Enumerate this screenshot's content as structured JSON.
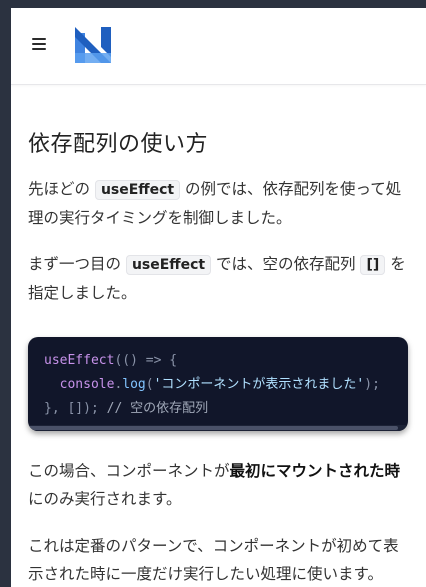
{
  "header": {
    "menu_icon": "hamburger-menu-icon",
    "logo_icon": "n-logo-icon",
    "logo_colors": {
      "dark": "#1f5fbf",
      "light": "#5aa0f0",
      "mid": "#3f83e0"
    }
  },
  "article": {
    "heading": "依存配列の使い方",
    "para1": {
      "before": "先ほどの ",
      "code": "useEffect",
      "after": " の例では、依存配列を使って処理の実行タイミングを制御しました。"
    },
    "para2": {
      "before": "まず一つ目の ",
      "code": "useEffect",
      "middle": " では、空の依存配列 ",
      "code2": "[]",
      "after": " を指定しました。"
    },
    "code_block": {
      "line1": {
        "fn": "useEffect",
        "rest": "(() => {"
      },
      "line2": {
        "indent": "  ",
        "obj": "console",
        "dot": ".",
        "method": "log",
        "open": "(",
        "str": "'コンポーネントが表示されました'",
        "close": ");"
      },
      "line3": {
        "punc": "}, []); ",
        "comment": "// 空の依存配列"
      }
    },
    "para3": {
      "before": "この場合、コンポーネントが",
      "bold": "最初にマウントされた時",
      "after": "にのみ実行されます。"
    },
    "para4": "これは定番のパターンで、コンポーネントが初めて表示された時に一度だけ実行したい処理に使います。"
  }
}
